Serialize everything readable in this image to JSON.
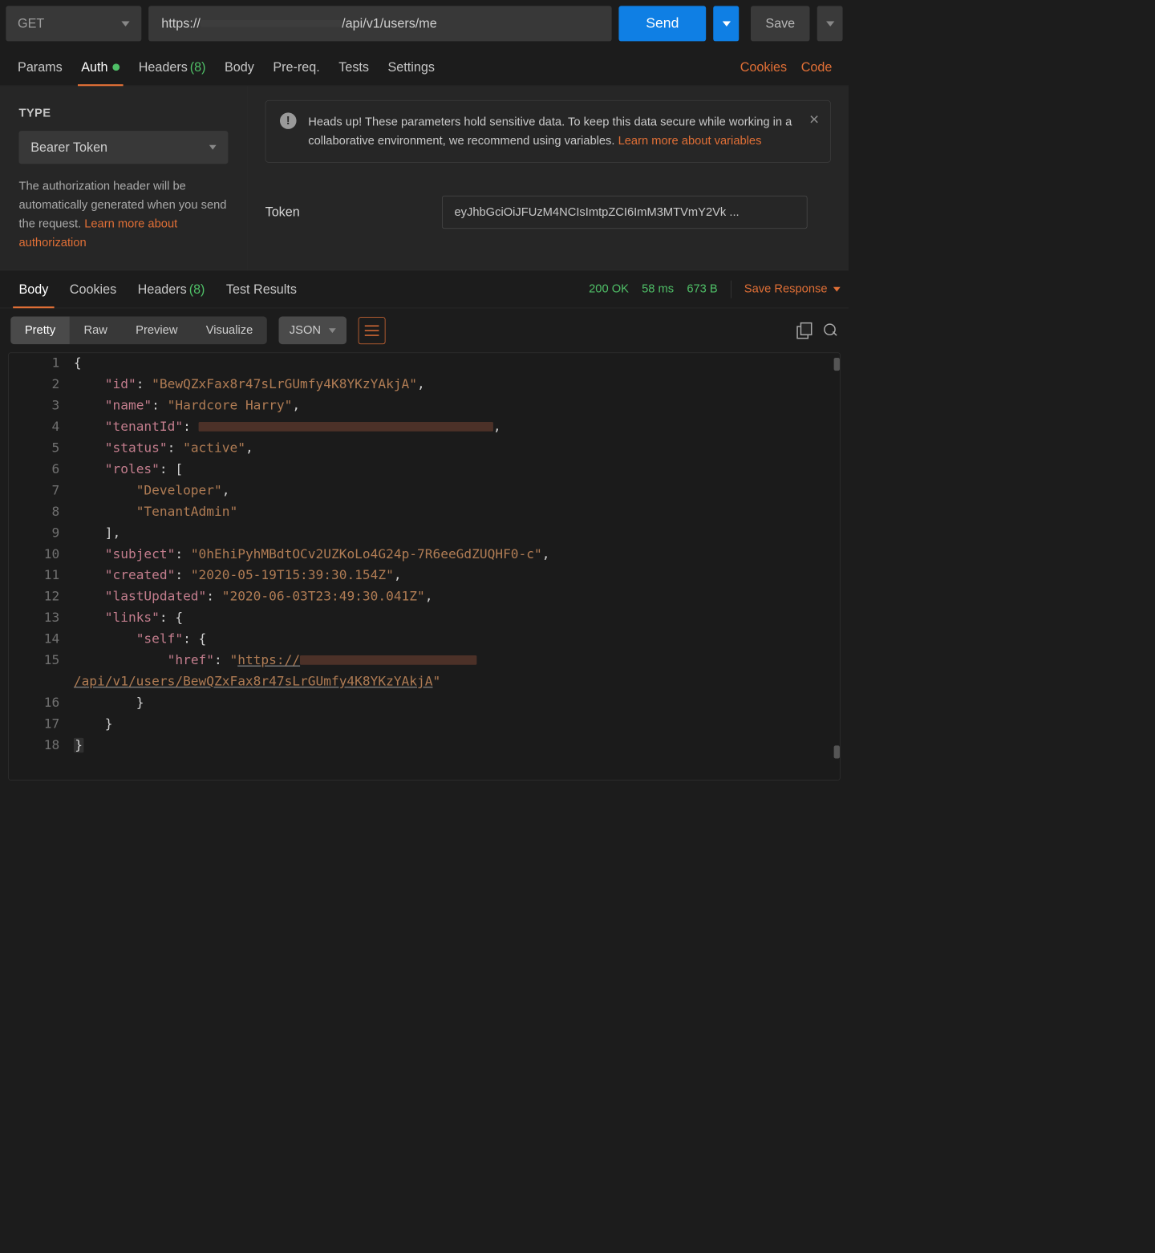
{
  "request": {
    "method": "GET",
    "url_prefix": "https://",
    "url_suffix": "/api/v1/users/me",
    "send": "Send",
    "save": "Save"
  },
  "tabs": {
    "params": "Params",
    "auth": "Auth",
    "headers": "Headers",
    "headers_count": "(8)",
    "body": "Body",
    "prereq": "Pre-req.",
    "tests": "Tests",
    "settings": "Settings",
    "cookies": "Cookies",
    "code": "Code"
  },
  "auth": {
    "type_label": "TYPE",
    "type_value": "Bearer Token",
    "note": "The authorization header will be automatically generated when you send the request. ",
    "learn_auth": "Learn more about authorization",
    "heads_up_text": "Heads up! These parameters hold sensitive data. To keep this data secure while working in a collaborative environment, we recommend using variables. ",
    "learn_vars": "Learn more about variables",
    "token_label": "Token",
    "token_value": "eyJhbGciOiJFUzM4NCIsImtpZCI6ImM3MTVmY2Vk ..."
  },
  "resp_tabs": {
    "body": "Body",
    "cookies": "Cookies",
    "headers": "Headers",
    "headers_count": "(8)",
    "tests": "Test Results"
  },
  "resp_meta": {
    "status": "200 OK",
    "time": "58 ms",
    "size": "673 B",
    "save": "Save Response"
  },
  "pretty": {
    "pretty": "Pretty",
    "raw": "Raw",
    "preview": "Preview",
    "visualize": "Visualize",
    "fmt": "JSON"
  },
  "json_lines": [
    {
      "n": 1,
      "i": 0,
      "tok": [
        [
          "p",
          "{"
        ]
      ]
    },
    {
      "n": 2,
      "i": 1,
      "tok": [
        [
          "k",
          "\"id\""
        ],
        [
          "p",
          ": "
        ],
        [
          "s",
          "\"BewQZxFax8r47sLrGUmfy4K8YKzYAkjA\""
        ],
        [
          "p",
          ","
        ]
      ]
    },
    {
      "n": 3,
      "i": 1,
      "tok": [
        [
          "k",
          "\"name\""
        ],
        [
          "p",
          ": "
        ],
        [
          "s",
          "\"Hardcore Harry\""
        ],
        [
          "p",
          ","
        ]
      ]
    },
    {
      "n": 4,
      "i": 1,
      "tok": [
        [
          "k",
          "\"tenantId\""
        ],
        [
          "p",
          ": "
        ],
        [
          "r",
          ""
        ],
        [
          "p",
          ","
        ]
      ]
    },
    {
      "n": 5,
      "i": 1,
      "tok": [
        [
          "k",
          "\"status\""
        ],
        [
          "p",
          ": "
        ],
        [
          "s",
          "\"active\""
        ],
        [
          "p",
          ","
        ]
      ]
    },
    {
      "n": 6,
      "i": 1,
      "tok": [
        [
          "k",
          "\"roles\""
        ],
        [
          "p",
          ": ["
        ]
      ]
    },
    {
      "n": 7,
      "i": 2,
      "tok": [
        [
          "s",
          "\"Developer\""
        ],
        [
          "p",
          ","
        ]
      ]
    },
    {
      "n": 8,
      "i": 2,
      "tok": [
        [
          "s",
          "\"TenantAdmin\""
        ]
      ]
    },
    {
      "n": 9,
      "i": 1,
      "tok": [
        [
          "p",
          "],"
        ]
      ]
    },
    {
      "n": 10,
      "i": 1,
      "tok": [
        [
          "k",
          "\"subject\""
        ],
        [
          "p",
          ": "
        ],
        [
          "s",
          "\"0hEhiPyhMBdtOCv2UZKoLo4G24p-7R6eeGdZUQHF0-c\""
        ],
        [
          "p",
          ","
        ]
      ]
    },
    {
      "n": 11,
      "i": 1,
      "tok": [
        [
          "k",
          "\"created\""
        ],
        [
          "p",
          ": "
        ],
        [
          "s",
          "\"2020-05-19T15:39:30.154Z\""
        ],
        [
          "p",
          ","
        ]
      ]
    },
    {
      "n": 12,
      "i": 1,
      "tok": [
        [
          "k",
          "\"lastUpdated\""
        ],
        [
          "p",
          ": "
        ],
        [
          "s",
          "\"2020-06-03T23:49:30.041Z\""
        ],
        [
          "p",
          ","
        ]
      ]
    },
    {
      "n": 13,
      "i": 1,
      "tok": [
        [
          "k",
          "\"links\""
        ],
        [
          "p",
          ": {"
        ]
      ]
    },
    {
      "n": 14,
      "i": 2,
      "tok": [
        [
          "k",
          "\"self\""
        ],
        [
          "p",
          ": {"
        ]
      ]
    },
    {
      "n": 15,
      "i": 3,
      "tok": [
        [
          "k",
          "\"href\""
        ],
        [
          "p",
          ": "
        ],
        [
          "s",
          "\""
        ],
        [
          "su",
          "https://"
        ],
        [
          "rs",
          ""
        ],
        [
          "su",
          "/api/v1/users/BewQZxFax8r47sLrGUmfy4K8YKzYAkjA"
        ],
        [
          "s",
          "\""
        ]
      ]
    },
    {
      "n": 16,
      "i": 2,
      "tok": [
        [
          "p",
          "}"
        ]
      ]
    },
    {
      "n": 17,
      "i": 1,
      "tok": [
        [
          "p",
          "}"
        ]
      ]
    },
    {
      "n": 18,
      "i": 0,
      "tok": [
        [
          "ph",
          "}"
        ]
      ]
    }
  ]
}
